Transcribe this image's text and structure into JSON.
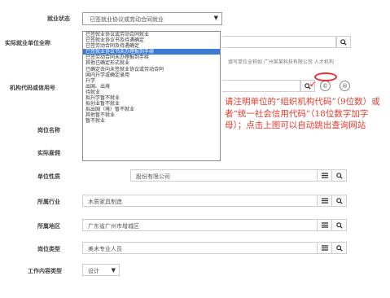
{
  "fields": {
    "employment_status": {
      "label": "就业状态",
      "value": "已签就业协议或劳动合同就业"
    },
    "employer_name": {
      "label": "实际就业单位全称"
    },
    "org_code": {
      "label": "机构代码或信用号"
    },
    "position_name": {
      "label": "岗位名称"
    },
    "actual_employer": {
      "label": "实际雇佣"
    },
    "unit_nature": {
      "label": "单位性质",
      "value": "股份有限公司"
    },
    "industry": {
      "label": "所属行业",
      "value": "木质家具制造"
    },
    "region": {
      "label": "所属地区",
      "value": "广东省广州市增城区"
    },
    "job_type": {
      "label": "岗位类型",
      "value": "美术专业人员"
    },
    "work_content_type": {
      "label": "工作内容类型",
      "value": "设计"
    }
  },
  "dropdown_options": [
    "已签就业协议或劳动合同就业",
    "已签就业协议书及待遇确定",
    "已签劳动合同及待遇确定",
    "已签就业协议书未办理报到手续",
    "已签劳动合同未办理报到手续",
    "其他已确定形式就业",
    "已确定去向未签就业协议或劳动合同",
    "国内升学或确定录用",
    "升学",
    "出国、出境",
    "待就业",
    "拟升学暂不就业",
    "拟创业暂不就业",
    "拟出国（境）暂不就业",
    "其他暂不就业",
    "暂不就业"
  ],
  "selected_option_index": 3,
  "hint_small": "填写单位全称如 广州某某科技有限公司 人才机构",
  "note_text": "请注明单位的“组织机构代码”（9位数）或者“统一社会信用代码”（18位数字加字母）；点击上图可以自动跳出查询网站",
  "colors": {
    "note": "#e23b2e",
    "highlight": "#3b7bd4",
    "ring": "#e53030"
  },
  "icons": {
    "search": "search-icon",
    "list": "list-icon",
    "copyright": "copyright-icon",
    "registered": "registered-icon"
  }
}
